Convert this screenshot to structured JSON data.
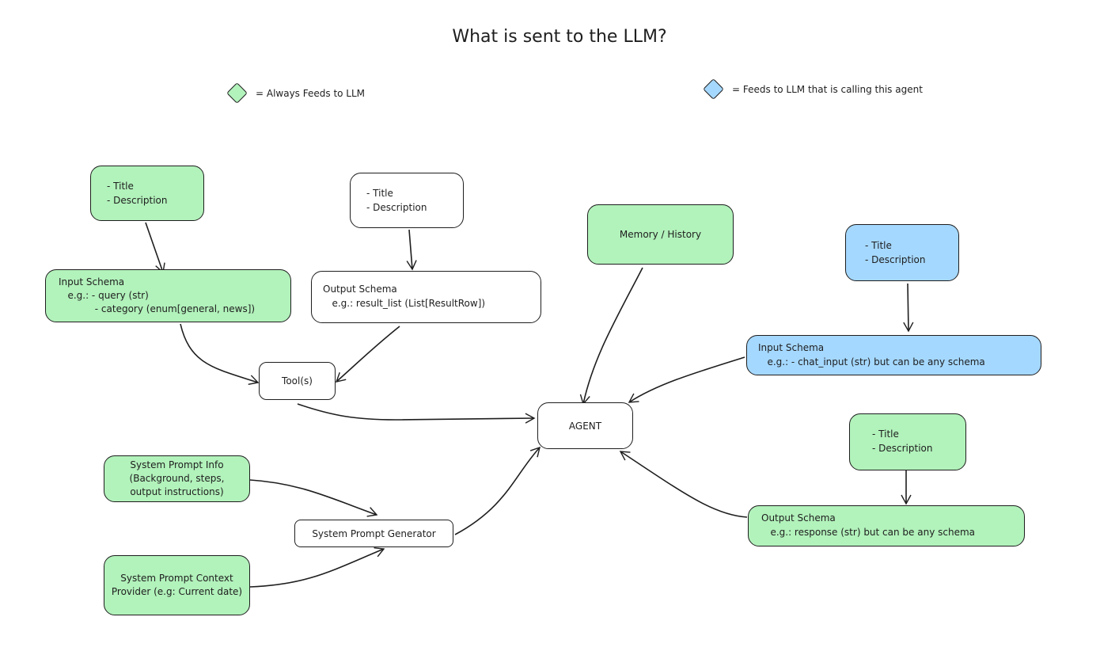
{
  "title": "What is sent to the LLM?",
  "legend": [
    {
      "icon": "green-diamond-icon",
      "color": "#b2f2bb",
      "label": "= Always Feeds to LLM"
    },
    {
      "icon": "blue-diamond-icon",
      "color": "#a5d8ff",
      "label": "= Feeds to LLM that is calling this agent"
    }
  ],
  "colors": {
    "always": "#b2f2bb",
    "caller": "#a5d8ff",
    "neutral": "#ffffff",
    "stroke": "#1e1e1e"
  },
  "nodes": {
    "tool_input_meta": {
      "lines": [
        "- Title",
        "- Description"
      ]
    },
    "tool_output_meta": {
      "lines": [
        "- Title",
        "- Description"
      ]
    },
    "tool_input_schema": {
      "lines": [
        "Input Schema",
        "   e.g.: - query (str)",
        "            - category (enum[general, news])"
      ]
    },
    "tool_output_schema": {
      "lines": [
        "Output Schema",
        "   e.g.: result_list (List[ResultRow])"
      ]
    },
    "tools": {
      "label": "Tool(s)"
    },
    "memory": {
      "label": "Memory / History"
    },
    "agent": {
      "label": "AGENT"
    },
    "agent_input_meta": {
      "lines": [
        "- Title",
        "- Description"
      ]
    },
    "agent_input_schema": {
      "lines": [
        "Input Schema",
        "   e.g.: - chat_input (str) but can be any schema"
      ]
    },
    "agent_output_meta": {
      "lines": [
        "- Title",
        "- Description"
      ]
    },
    "agent_output_schema": {
      "lines": [
        "Output Schema",
        "   e.g.: response (str) but can be any schema"
      ]
    },
    "sys_prompt_info": {
      "label": "System Prompt Info (Background, steps, output instructions)"
    },
    "sys_prompt_context": {
      "label": "System Prompt Context Provider (e.g: Current date)"
    },
    "sys_prompt_generator": {
      "label": "System Prompt Generator"
    }
  }
}
